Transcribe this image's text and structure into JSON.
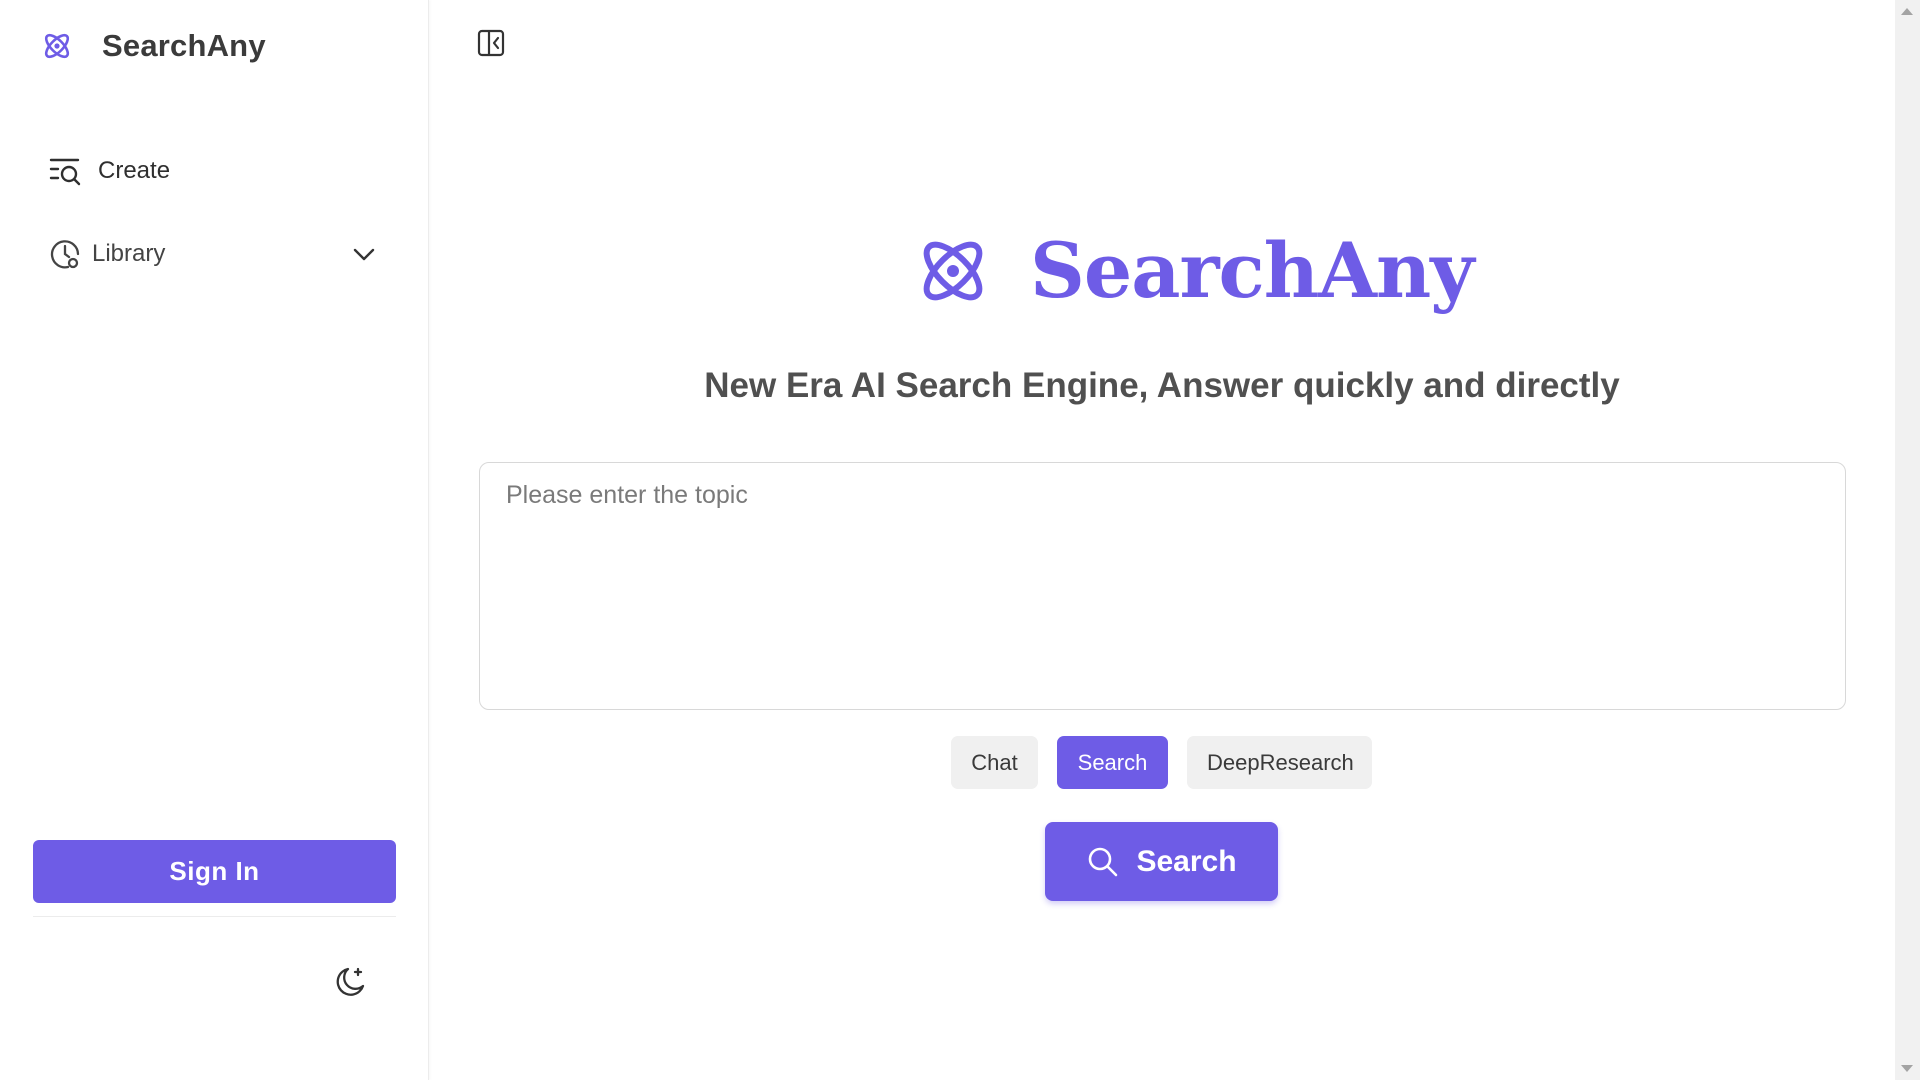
{
  "colors": {
    "accent": "#6e5ce6",
    "text": "#333333",
    "muted_bg": "#f0f0f0"
  },
  "sidebar": {
    "brand_name": "SearchAny",
    "brand_icon": "atom-icon",
    "items": [
      {
        "label": "Create",
        "icon": "list-search-icon"
      },
      {
        "label": "Library",
        "icon": "clock-icon",
        "expand_icon": "chevron-down-icon"
      }
    ],
    "signin_label": "Sign In",
    "theme_icon": "moon-icon"
  },
  "main": {
    "toggle_icon": "sidebar-toggle-icon",
    "hero_title": "SearchAny",
    "subtitle": "New Era AI Search Engine, Answer quickly and directly",
    "input": {
      "placeholder": "Please enter the topic",
      "value": ""
    },
    "modes": [
      {
        "label": "Chat",
        "active": false
      },
      {
        "label": "Search",
        "active": true
      },
      {
        "label": "DeepResearch",
        "active": false
      }
    ],
    "search_button_label": "Search",
    "search_button_icon": "search-icon"
  }
}
